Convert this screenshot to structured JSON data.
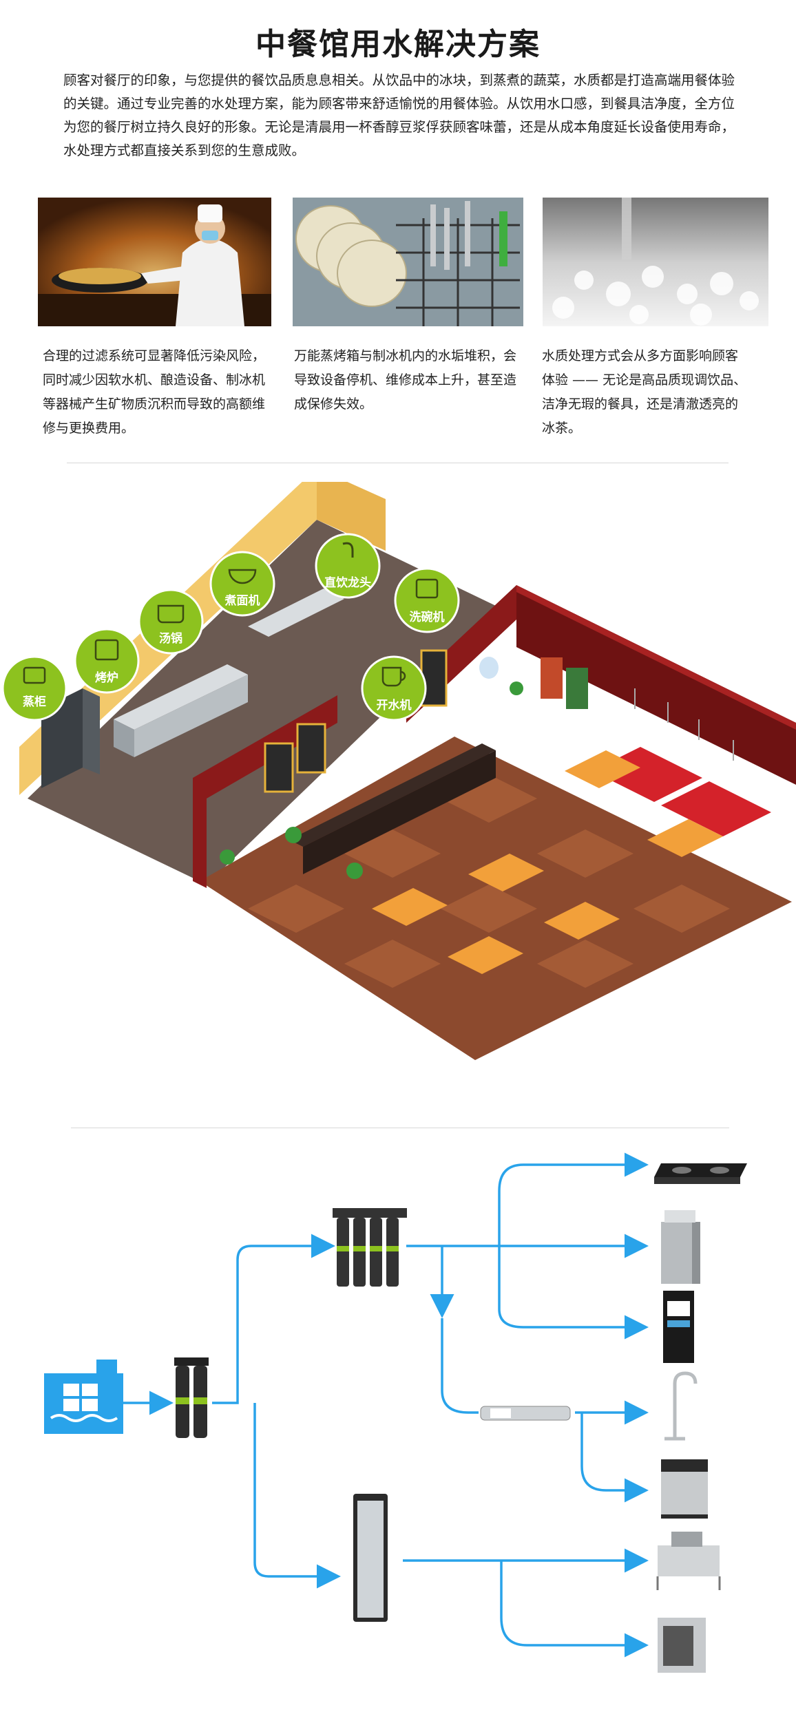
{
  "title": "中餐馆用水解决方案",
  "intro": "顾客对餐厅的印象，与您提供的餐饮品质息息相关。从饮品中的冰块，到蒸煮的蔬菜，水质都是打造高端用餐体验的关键。通过专业完善的水处理方案，能为顾客带来舒适愉悦的用餐体验。从饮用水口感，到餐具洁净度，全方位为您的餐厅树立持久良好的形象。无论是清晨用一杯香醇豆浆俘获顾客味蕾，还是从成本角度延长设备使用寿命，水处理方式都直接关系到您的生意成败。",
  "cards": [
    {
      "caption": "合理的过滤系统可显著降低污染风险，同时减少因软水机、酿造设备、制冰机等器械产生矿物质沉积而导致的高额维修与更换费用。"
    },
    {
      "caption": "万能蒸烤箱与制冰机内的水垢堆积，会导致设备停机、维修成本上升，甚至造成保修失效。"
    },
    {
      "caption": "水质处理方式会从多方面影响顾客体验 —— 无论是高品质现调饮品、洁净无瑕的餐具，还是清澈透亮的冰茶。"
    }
  ],
  "scene": {
    "badges": [
      {
        "label": "蒸柜",
        "icon": "steamer-icon"
      },
      {
        "label": "烤炉",
        "icon": "oven-icon"
      },
      {
        "label": "汤锅",
        "icon": "pot-icon"
      },
      {
        "label": "煮面机",
        "icon": "noodle-bowl-icon"
      },
      {
        "label": "直饮龙头",
        "icon": "faucet-icon"
      },
      {
        "label": "洗碗机",
        "icon": "dishwasher-icon"
      },
      {
        "label": "开水机",
        "icon": "cup-icon"
      }
    ]
  },
  "colors": {
    "accent_green": "#8dc21f",
    "flow_blue": "#29a3ea",
    "wall_red": "#8b1a1a"
  }
}
